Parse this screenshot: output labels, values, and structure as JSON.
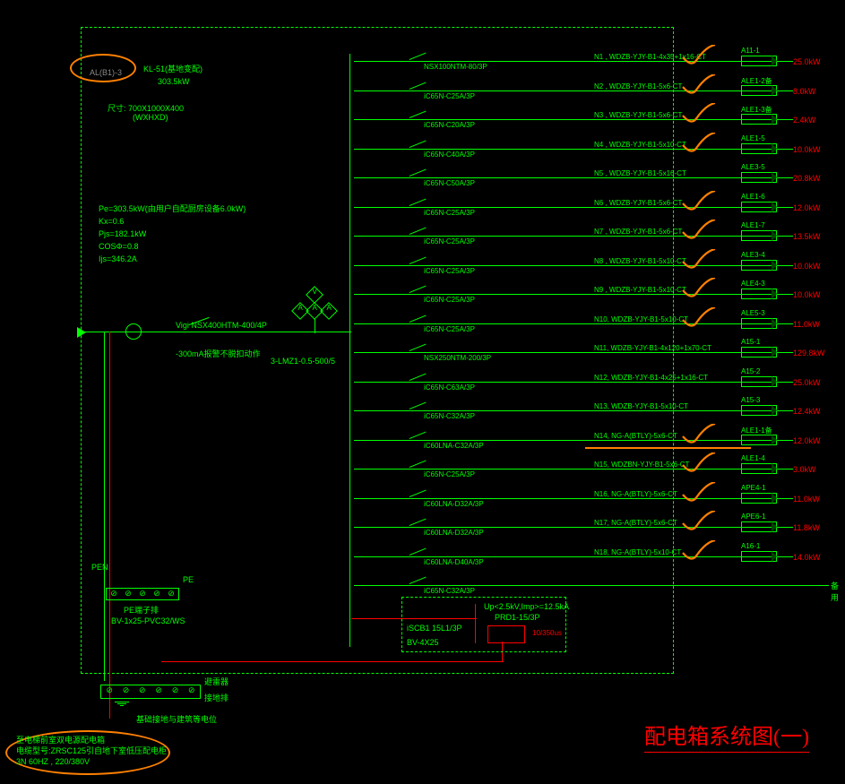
{
  "title": "配电箱系统图(一)",
  "panel": {
    "id_short": "AL(B1)-3",
    "name": "KL-51(基地变配)",
    "total_load": "303.5kW",
    "dims": "尺寸: 700X1000X400",
    "dims2": "(WXHXD)",
    "params": [
      "Pe=303.5kW(由用户自配厨房设备6.0kW)",
      "Kx=0.6",
      "Pjs=182.1kW",
      "COSΦ=0.8",
      "Ijs=346.2A"
    ],
    "main_breaker": "Vigi NSX400HTM-400/4P",
    "main_rc": "-300mA报警不脱扣动作",
    "ct": "3-LMZ1-0.5-500/5",
    "pen": "PEN",
    "pe": "PE",
    "pe_bar": "PE端子排",
    "pe_cable": "BV-1x25-PVC32/WS",
    "src1": "至电梯前室双电源配电箱",
    "src2": "电缆型号:ZRSC125引自地下室低压配电柜",
    "src3": "3N  60HZ , 220/380V",
    "meters": [
      "V",
      "A",
      "A",
      "A"
    ],
    "gnd1": "避雷器",
    "gnd2": "接地排",
    "gnd3": "基础接地与建筑等电位"
  },
  "spd": {
    "breaker": "iSCB1 15L1/3P",
    "cable": "BV-4X25",
    "device": "Up<2.5kV,Imp>=12.5kA",
    "model": "PRD1-15/3P",
    "wave": "10/350us"
  },
  "spare": "备用",
  "branches": [
    {
      "brk": "NSX100NTM-80/3P",
      "cbl": "N1 , WDZB-YJY-B1-4x35+1x16-CT",
      "dest": "A11-1",
      "load": "25.0kW",
      "mark": true
    },
    {
      "brk": "iC65N-C25A/3P",
      "cbl": "N2 , WDZB-YJY-B1-5x6-CT",
      "dest": "ALE1-2备",
      "load": "8.0kW",
      "mark": true
    },
    {
      "brk": "iC65N-C20A/3P",
      "cbl": "N3 , WDZB-YJY-B1-5x6-CT",
      "dest": "ALE1-3备",
      "load": "2.4kW",
      "mark": true
    },
    {
      "brk": "iC65N-C40A/3P",
      "cbl": "N4 , WDZB-YJY-B1-5x10-CT",
      "dest": "ALE1-5",
      "load": "10.0kW",
      "mark": true
    },
    {
      "brk": "iC65N-C50A/3P",
      "cbl": "N5 , WDZB-YJY-B1-5x16-CT",
      "dest": "ALE3-5",
      "load": "20.8kW",
      "mark": false
    },
    {
      "brk": "iC65N-C25A/3P",
      "cbl": "N6 , WDZB-YJY-B1-5x6-CT",
      "dest": "ALE1-6",
      "load": "12.0kW",
      "mark": true
    },
    {
      "brk": "iC65N-C25A/3P",
      "cbl": "N7 , WDZB-YJY-B1-5x6-CT",
      "dest": "ALE1-7",
      "load": "13.5kW",
      "mark": true
    },
    {
      "brk": "iC65N-C25A/3P",
      "cbl": "N8 , WDZB-YJY-B1-5x10-CT",
      "dest": "ALE3-4",
      "load": "10.0kW",
      "mark": true
    },
    {
      "brk": "iC65N-C25A/3P",
      "cbl": "N9 , WDZB-YJY-B1-5x10-CT",
      "dest": "ALE4-3",
      "load": "10.0kW",
      "mark": true
    },
    {
      "brk": "iC65N-C25A/3P",
      "cbl": "N10, WDZB-YJY-B1-5x10-CT",
      "dest": "ALE5-3",
      "load": "11.0kW",
      "mark": true
    },
    {
      "brk": "NSX250NTM-200/3P",
      "cbl": "N11, WDZB-YJY-B1-4x120+1x70-CT",
      "dest": "A15-1",
      "load": "129.8kW",
      "mark": false
    },
    {
      "brk": "iC65N-C63A/3P",
      "cbl": "N12, WDZB-YJY-B1-4x25+1x16-CT",
      "dest": "A15-2",
      "load": "25.0kW",
      "mark": false
    },
    {
      "brk": "iC65N-C32A/3P",
      "cbl": "N13, WDZB-YJY-B1-5x10-CT",
      "dest": "A15-3",
      "load": "12.4kW",
      "mark": false
    },
    {
      "brk": "iC60LNA-C32A/3P",
      "cbl": "N14, NG-A(BTLY)-5x6-CT",
      "dest": "ALE1-1备",
      "load": "12.0kW",
      "mark": true
    },
    {
      "brk": "iC65N-C25A/3P",
      "cbl": "N15, WDZBN-YJY-B1-5x6-CT",
      "dest": "ALE1-4",
      "load": "3.0kW",
      "mark": true
    },
    {
      "brk": "iC60LNA-D32A/3P",
      "cbl": "N16, NG-A(BTLY)-5x6-CT",
      "dest": "APE4-1",
      "load": "11.0kW",
      "mark": true
    },
    {
      "brk": "iC60LNA-D32A/3P",
      "cbl": "N17, NG-A(BTLY)-5x6-CT",
      "dest": "APE6-1",
      "load": "11.8kW",
      "mark": true
    },
    {
      "brk": "iC60LNA-D40A/3P",
      "cbl": "N18, NG-A(BTLY)-5x10-CT",
      "dest": "A16-1",
      "load": "14.0kW",
      "mark": true
    },
    {
      "brk": "iC65N-C32A/3P",
      "cbl": "",
      "dest": "",
      "load": "",
      "mark": false,
      "spare": true
    }
  ]
}
